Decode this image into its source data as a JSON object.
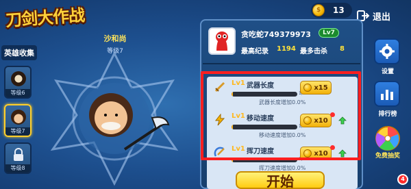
{
  "header": {
    "logo_text": "刀剑大作战",
    "coins": "13",
    "exit_label": "退出"
  },
  "sidebar": {
    "title": "英雄收集",
    "heroes": [
      {
        "level": "等级6",
        "locked": false
      },
      {
        "level": "等级7",
        "locked": false,
        "selected": true
      },
      {
        "level": "等级8",
        "locked": true
      }
    ]
  },
  "hero": {
    "name": "沙和尚",
    "level": "等级7"
  },
  "profile": {
    "player_name": "贪吃蛇749379973",
    "level_badge": "Lv7",
    "best_record_label": "最高纪录",
    "best_record_value": "1194",
    "most_kills_label": "最多击杀",
    "most_kills_value": "8"
  },
  "upgrades": [
    {
      "lv": "Lv1",
      "name": "武器长度",
      "progress_text": "1/50",
      "progress": 0.02,
      "desc": "武器长度增加0.0%",
      "cost": "x15",
      "icon": "sword-icon",
      "has_red_dot": false,
      "has_arrow": false
    },
    {
      "lv": "Lv1",
      "name": "移动速度",
      "progress_text": "1/50",
      "progress": 0.02,
      "desc": "移动速度增加0.0%",
      "cost": "x10",
      "icon": "lightning-icon",
      "has_red_dot": true,
      "has_arrow": true
    },
    {
      "lv": "Lv1",
      "name": "挥刀速度",
      "progress_text": "1/50",
      "progress": 0.02,
      "desc": "挥刀速度增加0.0%",
      "cost": "x10",
      "icon": "swing-icon",
      "has_red_dot": true,
      "has_arrow": true
    }
  ],
  "start_label": "开始",
  "right_buttons": {
    "settings": "设置",
    "leaderboard": "排行榜",
    "lottery": "免费抽奖",
    "lottery_badge": "4"
  },
  "colors": {
    "accent_gold": "#ffd23a",
    "highlight_red": "#ff1f1f",
    "level_green": "#1b8a2e"
  }
}
